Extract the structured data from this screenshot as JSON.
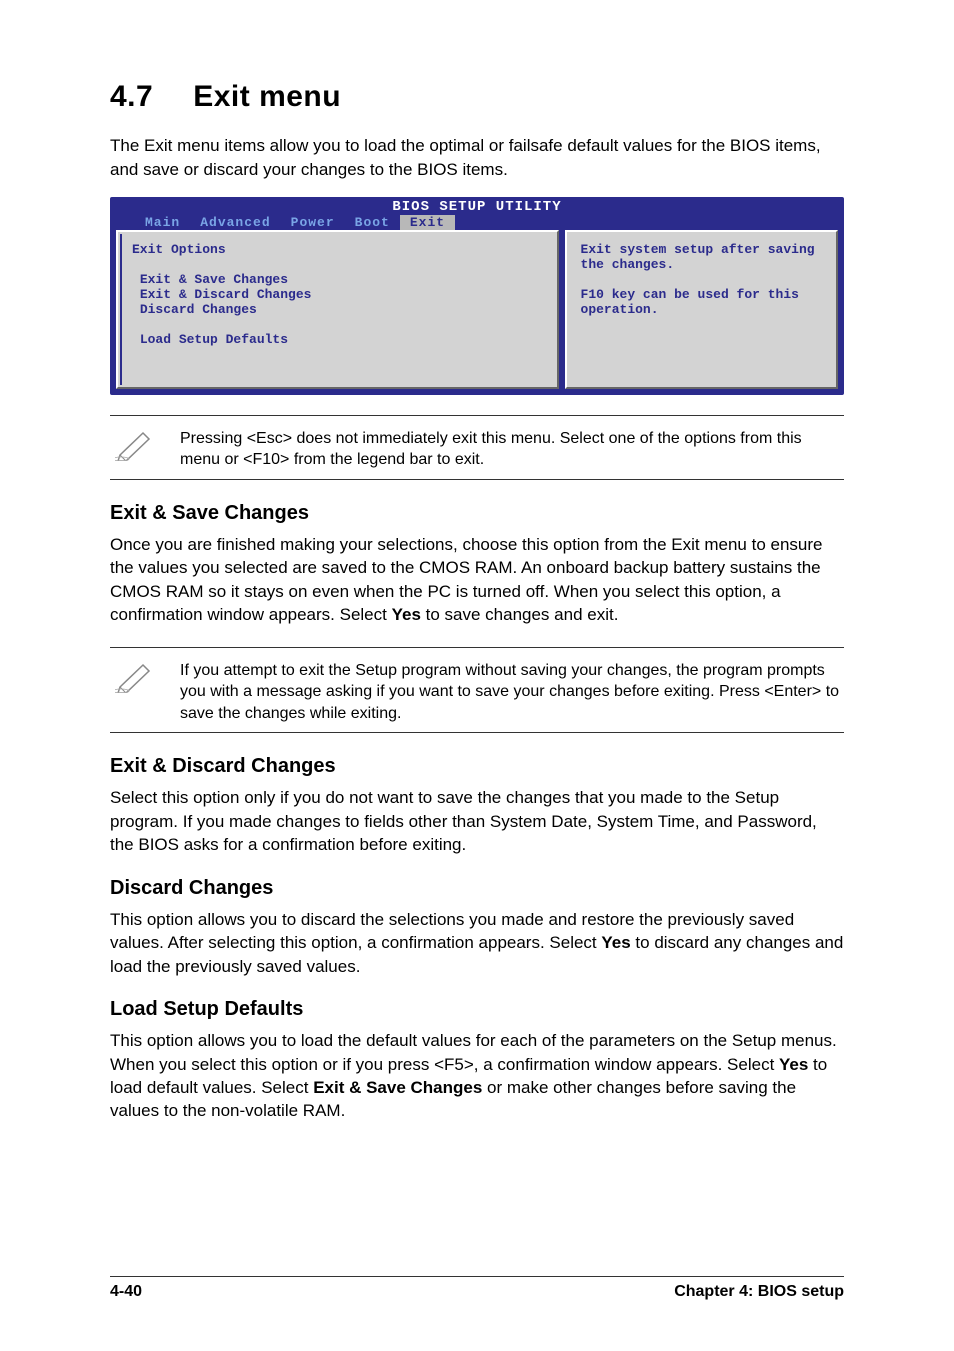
{
  "section": {
    "number": "4.7",
    "title": "Exit menu",
    "intro": "The Exit menu items allow you to load the optimal or failsafe default values for the BIOS items, and save or discard your changes to the BIOS items."
  },
  "bios": {
    "header": "BIOS SETUP UTILITY",
    "tabs": [
      "Main",
      "Advanced",
      "Power",
      "Boot",
      "Exit"
    ],
    "active_tab": "Exit",
    "main_title": "Exit Options",
    "options": [
      "Exit & Save Changes",
      "Exit & Discard Changes",
      "Discard Changes",
      "",
      "Load Setup Defaults"
    ],
    "help": "Exit system setup after saving the changes.\n\nF10 key can be used for this operation."
  },
  "note1": "Pressing <Esc> does not immediately exit this menu. Select one of the options from this menu or <F10> from the legend bar to exit.",
  "exit_save": {
    "heading": "Exit & Save Changes",
    "body_pre": "Once you are finished making your selections, choose this option from the Exit menu to ensure the values you selected are saved to the CMOS RAM. An onboard backup battery sustains the CMOS RAM so it stays on even when the PC is turned off. When you select this option, a confirmation window appears. Select ",
    "yes": "Yes",
    "body_post": " to save changes and exit."
  },
  "note2": "If you attempt to exit the Setup program without saving your changes, the program prompts you with a message asking if you want to save your changes before exiting. Press <Enter>  to save the  changes while exiting.",
  "exit_discard": {
    "heading": "Exit & Discard Changes",
    "body": "Select this option only if you do not want to save the changes that you made to the Setup program. If you made changes to fields other than System Date, System Time, and Password, the BIOS asks for a confirmation before exiting."
  },
  "discard": {
    "heading": "Discard Changes",
    "body_pre": "This option allows you to discard the selections you made and restore the previously saved values. After selecting this option, a confirmation appears. Select ",
    "yes": "Yes",
    "body_post": " to discard any changes and load the previously saved values."
  },
  "load_defaults": {
    "heading": "Load Setup Defaults",
    "body_pre": "This option allows you to load the default values for each of the parameters on the Setup menus. When you select this option or if you press <F5>, a confirmation window appears. Select ",
    "yes": "Yes",
    "body_mid": " to load default values. Select ",
    "exit_save": "Exit & Save Changes",
    "body_post": " or make other changes before saving the values to the non-volatile RAM."
  },
  "footer": {
    "page": "4-40",
    "chapter": "Chapter 4: BIOS setup"
  }
}
